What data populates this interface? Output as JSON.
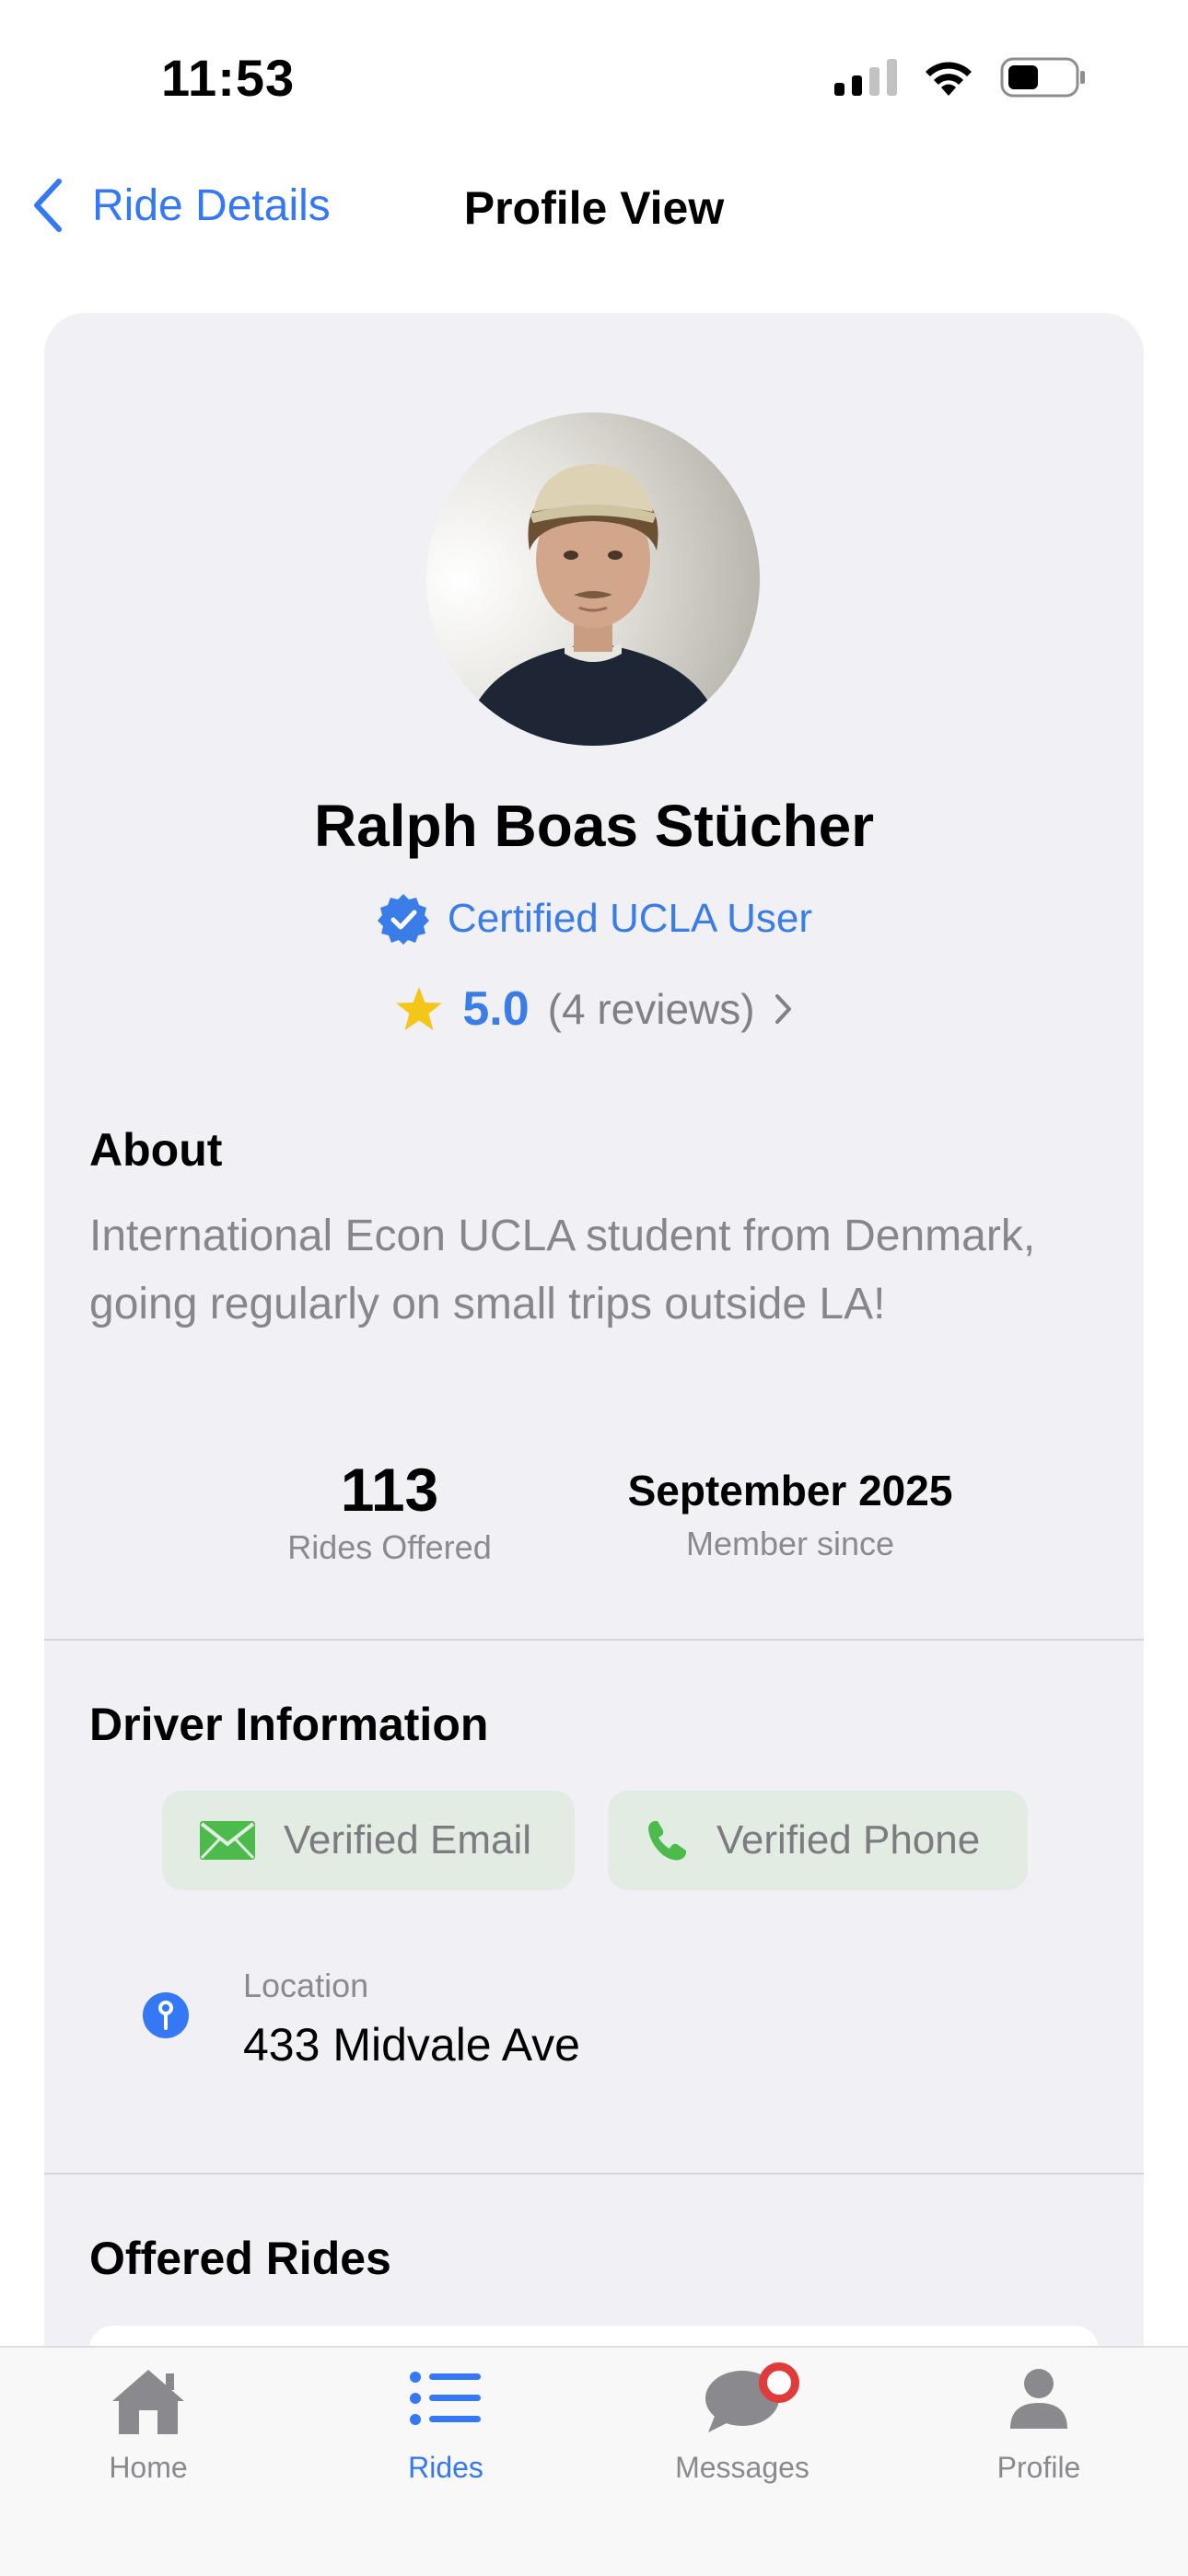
{
  "status_bar": {
    "time": "11:53",
    "icons": [
      "cellular-signal-icon",
      "wifi-icon",
      "battery-icon"
    ]
  },
  "nav": {
    "back_label": "Ride Details",
    "title": "Profile View"
  },
  "profile": {
    "name": "Ralph Boas Stücher",
    "certified_label": "Certified UCLA User",
    "rating": "5.0",
    "reviews": "(4 reviews)",
    "about_title": "About",
    "about_text": "International Econ UCLA student from Denmark, going regularly on small trips outside LA!",
    "stats": [
      {
        "value": "113",
        "label": "Rides Offered"
      },
      {
        "value": "September 2025",
        "label": "Member since"
      }
    ]
  },
  "driver_info": {
    "title": "Driver Information",
    "chips": [
      {
        "label": "Verified Email",
        "icon": "envelope-icon"
      },
      {
        "label": "Verified Phone",
        "icon": "phone-icon"
      }
    ],
    "location_label": "Location",
    "location_value": "433 Midvale Ave"
  },
  "offered_rides": {
    "title": "Offered Rides"
  },
  "tab_bar": {
    "tabs": [
      {
        "label": "Home",
        "icon": "house-icon",
        "active": false
      },
      {
        "label": "Rides",
        "icon": "list-icon",
        "active": true
      },
      {
        "label": "Messages",
        "icon": "chat-bubble-icon",
        "active": false,
        "badge": true
      },
      {
        "label": "Profile",
        "icon": "person-icon",
        "active": false
      }
    ]
  },
  "colors": {
    "accent": "#3478f6",
    "card_bg": "#f0f0f5",
    "chip_bg": "#e2ece3",
    "verified_green": "#4cbb4c",
    "star": "#f5c518",
    "badge_red": "#e03a3a"
  }
}
